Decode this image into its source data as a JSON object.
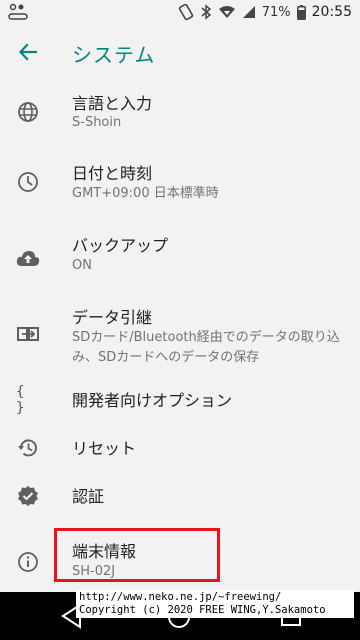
{
  "status_bar": {
    "battery": "71%",
    "time": "20:55"
  },
  "header": {
    "title": "システム"
  },
  "items": [
    {
      "title": "言語と入力",
      "subtitle": "S-Shoin"
    },
    {
      "title": "日付と時刻",
      "subtitle": "GMT+09:00 日本標準時"
    },
    {
      "title": "バックアップ",
      "subtitle": "ON"
    },
    {
      "title": "データ引継",
      "subtitle": "SDカード/Bluetooth経由でのデータの取り込み、SDカードへのデータの保存"
    },
    {
      "title": "開発者向けオプション",
      "icon_text": "{ }"
    },
    {
      "title": "リセット"
    },
    {
      "title": "認証"
    },
    {
      "title": "端末情報",
      "subtitle": "SH-02J"
    }
  ],
  "watermark": {
    "line1": "http://www.neko.ne.jp/~freewing/",
    "line2": "Copyright (c) 2020 FREE WING,Y.Sakamoto"
  },
  "colors": {
    "accent": "#00887a",
    "highlight": "#e8141b",
    "background": "#f2f2f2"
  },
  "icons": [
    "globe-icon",
    "clock-icon",
    "cloud-upload-icon",
    "data-transfer-icon",
    "developer-braces-icon",
    "restore-icon",
    "verified-badge-icon",
    "info-icon"
  ]
}
